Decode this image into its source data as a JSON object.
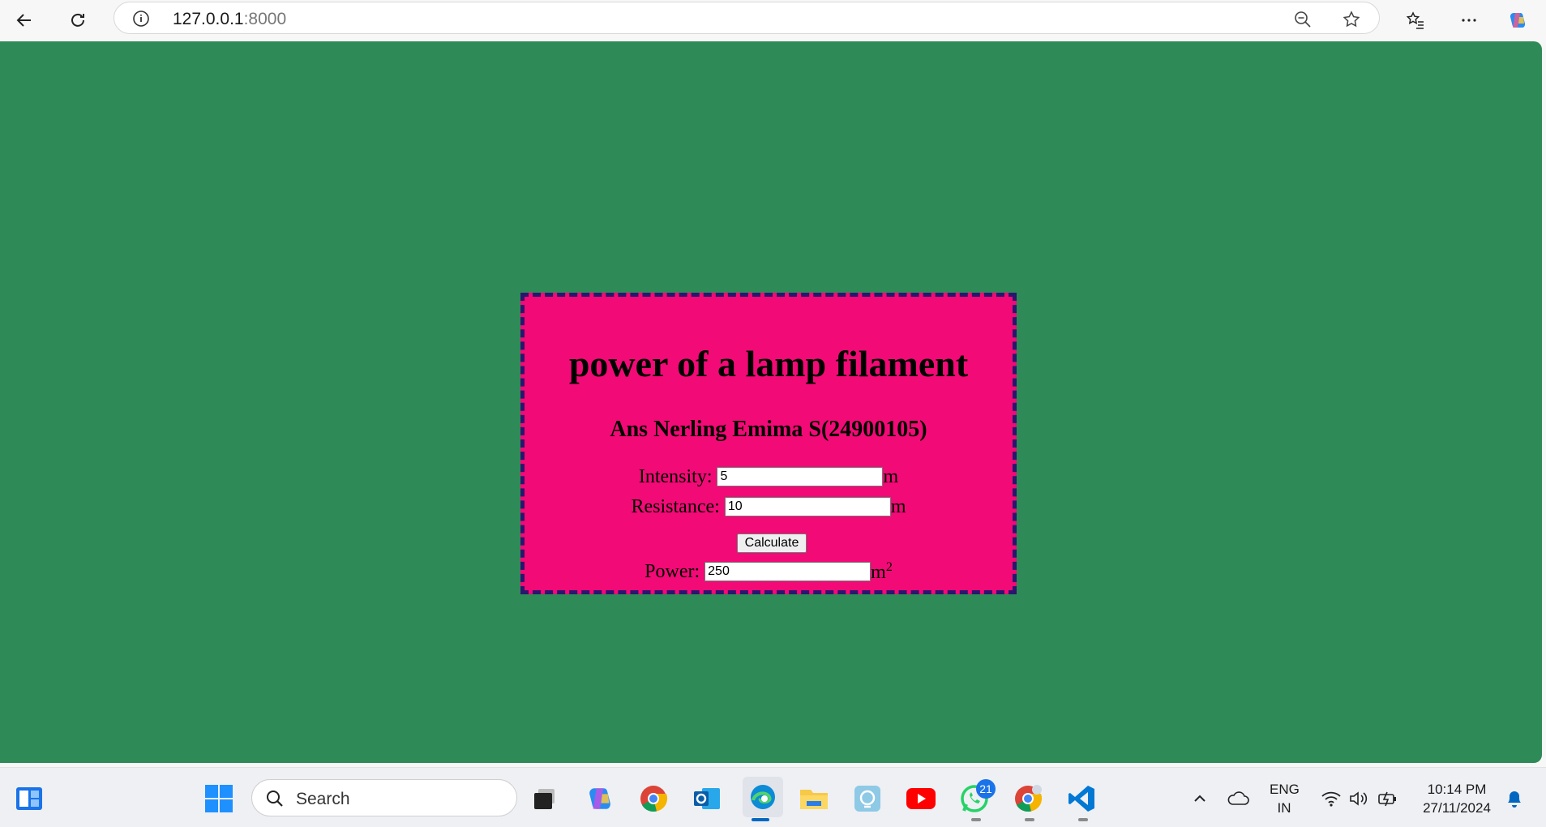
{
  "browser": {
    "url_host": "127.0.0.1",
    "url_port": ":8000"
  },
  "page": {
    "title": "power of a lamp filament",
    "author": "Ans Nerling Emima S(24900105)",
    "intensity": {
      "label": "Intensity:",
      "value": "5",
      "unit": "m"
    },
    "resistance": {
      "label": "Resistance:",
      "value": "10",
      "unit": "m"
    },
    "calculate_label": "Calculate",
    "power": {
      "label": "Power:",
      "value": "250",
      "unit": "m",
      "unit_sup": "2"
    },
    "colors": {
      "background": "#2e8b57",
      "card": "#f20a76",
      "border": "#2a166e"
    }
  },
  "taskbar": {
    "search_label": "Search",
    "whatsapp_badge": "21",
    "lang_line1": "ENG",
    "lang_line2": "IN",
    "time": "10:14 PM",
    "date": "27/11/2024"
  }
}
